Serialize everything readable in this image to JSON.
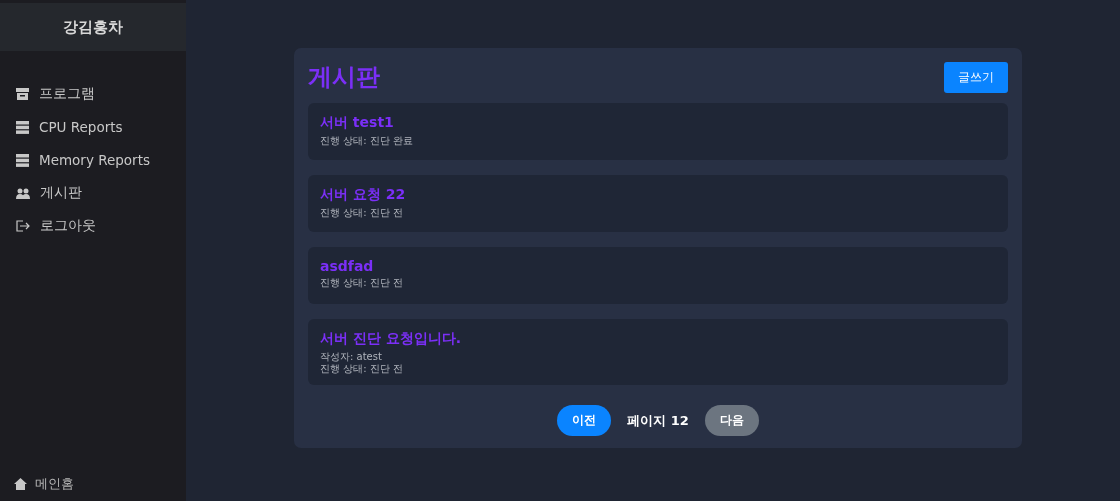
{
  "sidebar": {
    "title": "강김홍차",
    "items": [
      {
        "label": "프로그램"
      },
      {
        "label": "CPU Reports"
      },
      {
        "label": "Memory Reports"
      },
      {
        "label": "게시판"
      },
      {
        "label": "로그아웃"
      }
    ],
    "footer": {
      "label": "메인홈"
    }
  },
  "board": {
    "title": "게시판",
    "write_button": "글쓰기",
    "posts": [
      {
        "title": "서버 test1",
        "status": "진행 상태: 진단 완료"
      },
      {
        "title": "서버 요청 22",
        "status": "진행 상태: 진단 전"
      },
      {
        "title": "asdfad",
        "status": "진행 상태: 진단 전"
      },
      {
        "title": "서버 진단 요청입니다.",
        "author": "작성자: atest",
        "status": "진행 상태: 진단 전"
      }
    ],
    "pagination": {
      "prev": {
        "label": "이전",
        "disabled": false
      },
      "page": "페이지 12",
      "next": {
        "label": "다음",
        "disabled": true
      }
    }
  }
}
